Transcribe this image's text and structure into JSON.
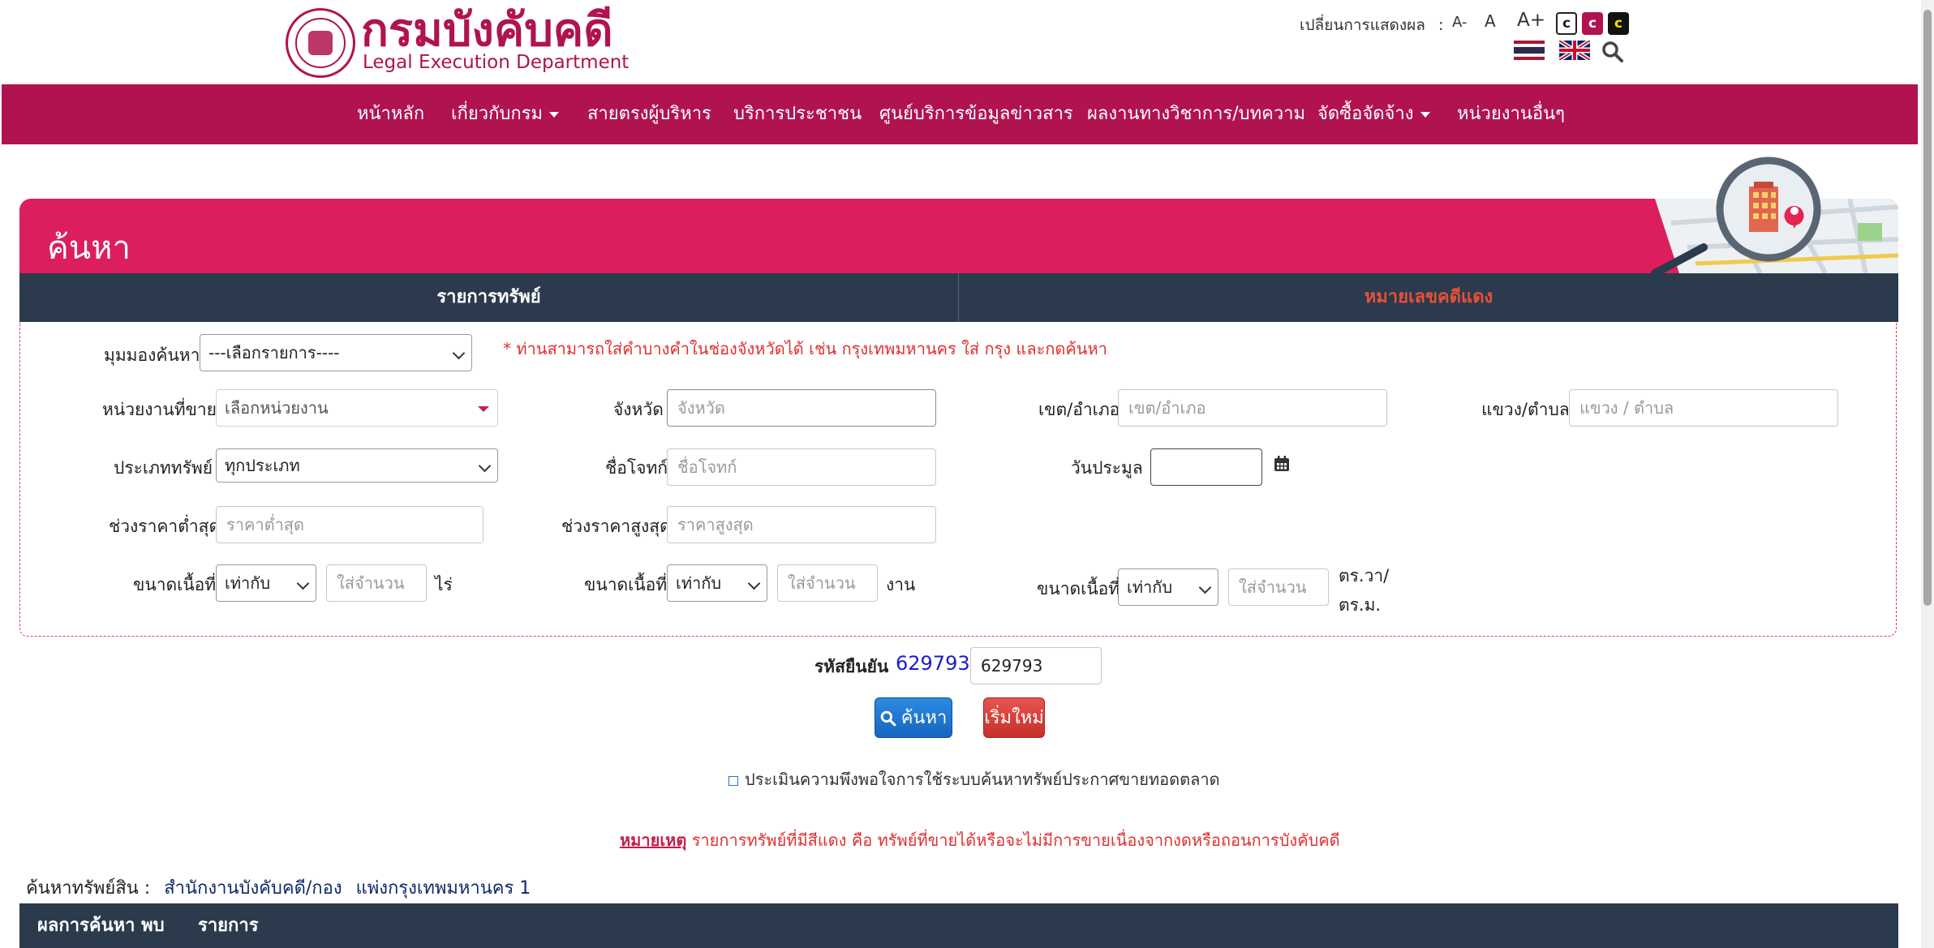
{
  "header": {
    "logo_th": "กรมบังคับคดี",
    "logo_en": "Legal Execution Department",
    "display_label": "เปลี่ยนการแสดงผล",
    "display_sep": ":",
    "font_small": "A-",
    "font_normal": "A",
    "font_large": "A+",
    "contrast_normal": "c",
    "contrast_pink": "c",
    "contrast_dark": "c",
    "colors": {
      "brand": "#b0134f",
      "banner": "#dc1e5c",
      "dark": "#2b3a4c"
    }
  },
  "nav": {
    "items": [
      {
        "label": "หน้าหลัก"
      },
      {
        "label": "เกี่ยวกับกรม",
        "dropdown": true
      },
      {
        "label": "สายตรงผู้บริหาร"
      },
      {
        "label": "บริการประชาชน"
      },
      {
        "label": "ศูนย์บริการข้อมูลข่าวสาร"
      },
      {
        "label": "ผลงานทางวิชาการ/บทความ"
      },
      {
        "label": "จัดซื้อจัดจ้าง",
        "dropdown": true
      },
      {
        "label": "หน่วยงานอื่นๆ"
      }
    ]
  },
  "search": {
    "title": "ค้นหา",
    "tabs": [
      {
        "label": "รายการทรัพย์",
        "active": true,
        "color": "#ffffff"
      },
      {
        "label": "หมายเลขคดีแดง",
        "active": false,
        "color": "#e8503a"
      }
    ],
    "view_label": "มุมมองค้นหา",
    "view_value": "---เลือกรายการ----",
    "note": "* ท่านสามารถใส่คำบางคำในช่องจังหวัดได้ เช่น กรุงเทพมหานคร ใส่ กรุง และกดค้นหา",
    "unit_label": "หน่วยงานที่ขาย",
    "unit_value": "เลือกหน่วยงาน",
    "province_label": "จังหวัด",
    "province_placeholder": "จังหวัด",
    "district_label": "เขต/อำเภอ",
    "district_placeholder": "เขต/อำเภอ",
    "subdistrict_label": "แขวง/ตำบล",
    "subdistrict_placeholder": "แขวง / ตำบล",
    "type_label": "ประเภททรัพย์",
    "type_value": "ทุกประเภท",
    "plaintiff_label": "ชื่อโจทก์",
    "plaintiff_placeholder": "ชื่อโจทก์",
    "auction_date_label": "วันประมูล",
    "price_min_label": "ช่วงราคาต่ำสุด",
    "price_min_placeholder": "ราคาต่ำสุด",
    "price_max_label": "ช่วงราคาสูงสุด",
    "price_max_placeholder": "ราคาสูงสุด",
    "area_label": "ขนาดเนื้อที่",
    "area_operator": "เท่ากับ",
    "area_placeholder": "ใส่จำนวน",
    "unit_rai": "ไร่",
    "unit_ngan": "งาน",
    "unit_wa_1": "ตร.วา/",
    "unit_wa_2": "ตร.ม.",
    "captcha_label": "รหัสยืนยัน",
    "captcha_code": "629793",
    "captcha_value": "629793",
    "search_button": "ค้นหา",
    "reset_button": "เริ่มใหม่",
    "survey_link": "ประเมินความพึงพอใจการใช้ระบบค้นหาทรัพย์ประกาศขายทอดตลาด",
    "remark_label": "หมายเหตุ",
    "remark_text": "รายการทรัพย์ที่มีสีแดง คือ ทรัพย์ที่ขายได้หรือจะไม่มีการขายเนื่องจากงดหรือถอนการบังคับคดี"
  },
  "results": {
    "title_prefix": "ค้นหาทรัพย์สิน :",
    "title_org": "สำนักงานบังคับคดี/กอง",
    "title_place": "แพ่งกรุงเทพมหานคร 1",
    "found_label": "ผลการค้นหา พบ",
    "items_label": "รายการ"
  }
}
